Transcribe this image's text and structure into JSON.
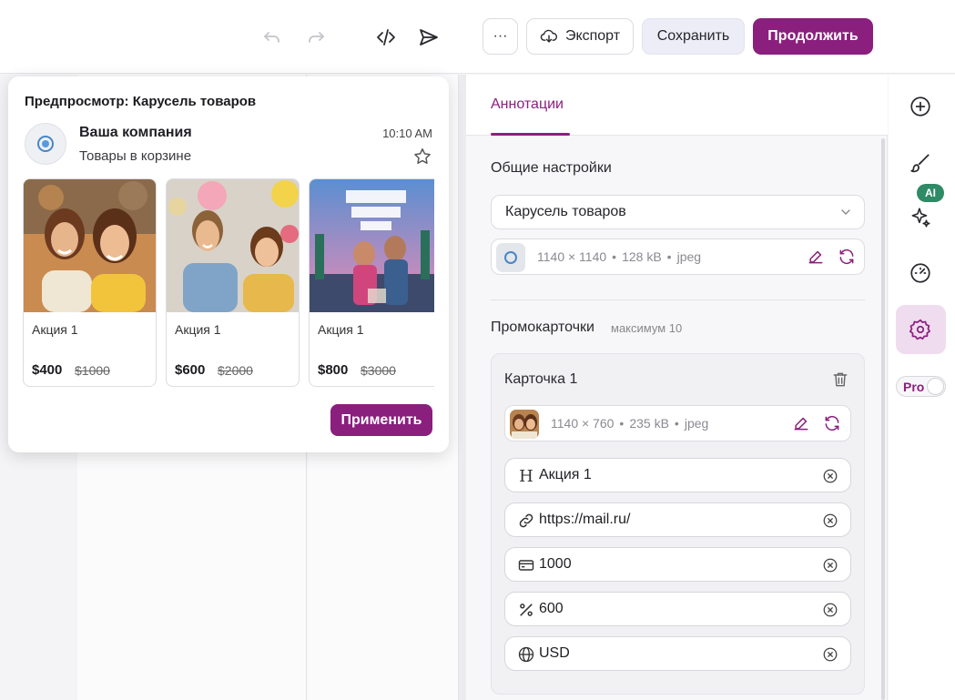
{
  "toolbar": {
    "more_label": "···",
    "export_label": "Экспорт",
    "save_label": "Сохранить",
    "continue_label": "Продолжить"
  },
  "preview": {
    "title": "Предпросмотр: Карусель товаров",
    "company": "Ваша компания",
    "subtitle": "Товары в корзине",
    "time": "10:10 AM",
    "cards": [
      {
        "label": "Акция 1",
        "price": "$400",
        "old_price": "$1000"
      },
      {
        "label": "Акция 1",
        "price": "$600",
        "old_price": "$2000"
      },
      {
        "label": "Акция 1",
        "price": "$800",
        "old_price": "$3000"
      }
    ],
    "apply_label": "Применить"
  },
  "panel": {
    "tab": "Аннотации",
    "general_title": "Общие настройки",
    "select_value": "Карусель товаров",
    "logo_file": {
      "dims": "1140 × 1140",
      "size": "128 kB",
      "type": "jpeg"
    },
    "promo_title": "Промокарточки",
    "promo_max": "максимум 10",
    "card": {
      "title": "Карточка 1",
      "file": {
        "dims": "1140 × 760",
        "size": "235 kB",
        "type": "jpeg"
      },
      "fields": [
        {
          "icon": "heading-icon",
          "value": "Акция 1"
        },
        {
          "icon": "link-icon",
          "value": "https://mail.ru/"
        },
        {
          "icon": "card-icon",
          "value": "1000"
        },
        {
          "icon": "percent-icon",
          "value": "600"
        },
        {
          "icon": "globe-icon",
          "value": "USD"
        }
      ]
    }
  },
  "rail": {
    "ai_badge": "AI",
    "pro_label": "Pro"
  },
  "colors": {
    "accent": "#8a1f7d",
    "ai_badge": "#2e8b65"
  }
}
